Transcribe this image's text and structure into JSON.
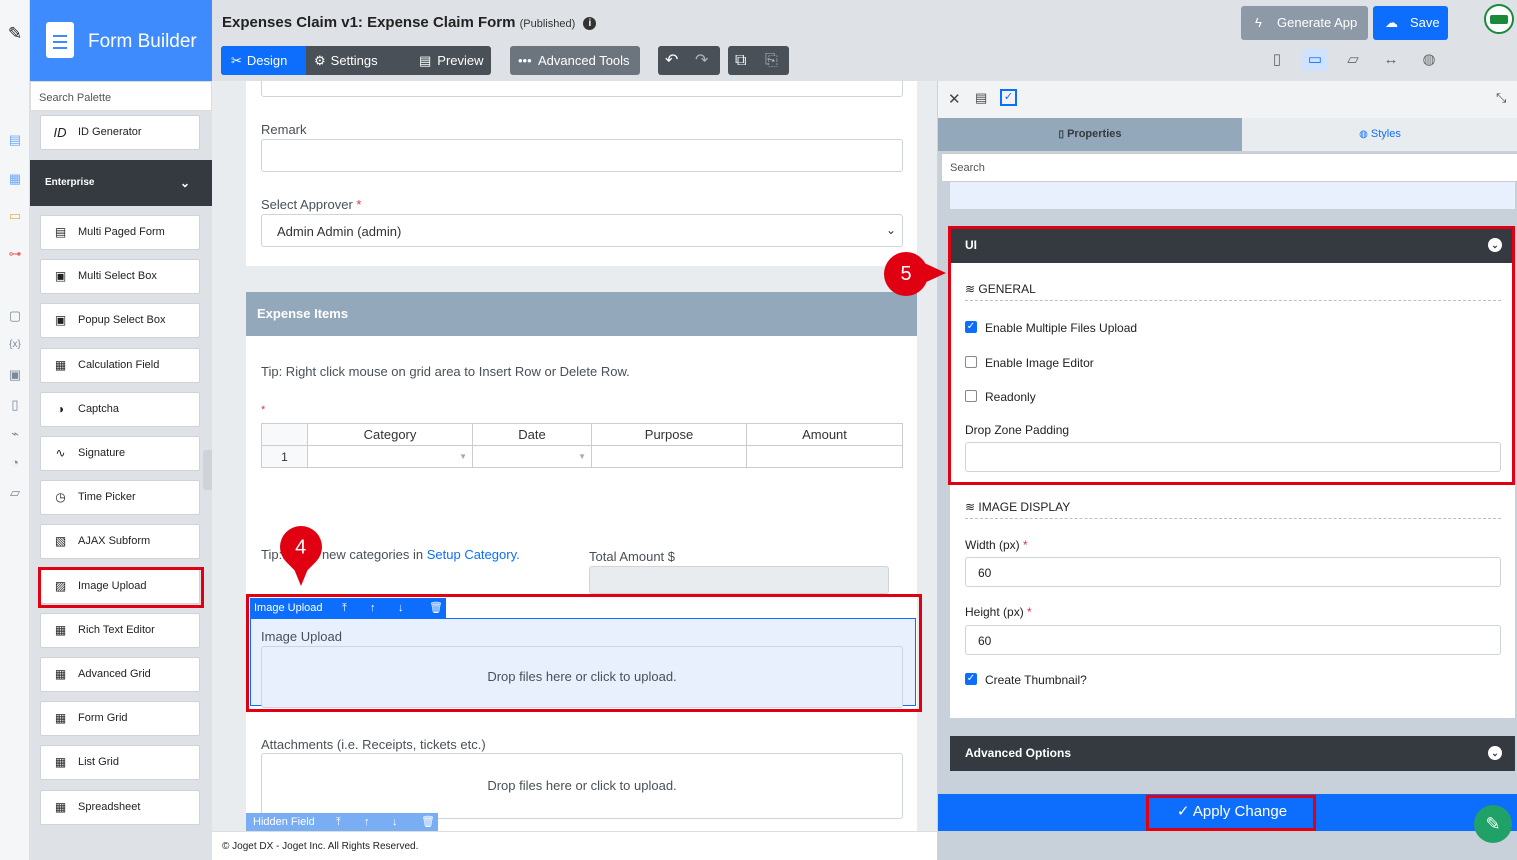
{
  "palette": {
    "title": "Form Builder",
    "search_placeholder": "Search Palette",
    "top_item": "ID Generator",
    "top_item_icon": "ID",
    "category": "Enterprise",
    "items": [
      "Multi Paged Form",
      "Multi Select Box",
      "Popup Select Box",
      "Calculation Field",
      "Captcha",
      "Signature",
      "Time Picker",
      "AJAX Subform",
      "Image Upload",
      "Rich Text Editor",
      "Advanced Grid",
      "Form Grid",
      "List Grid",
      "Spreadsheet"
    ]
  },
  "header": {
    "title": "Expenses Claim v1: Expense Claim Form",
    "status": "(Published)",
    "tabs": [
      "Design",
      "Settings",
      "Preview"
    ],
    "advanced_tools": "Advanced Tools",
    "generate_app": "Generate App",
    "save": "Save"
  },
  "form": {
    "remark_label": "Remark",
    "approver_label": "Select Approver",
    "approver_value": "Admin Admin (admin)",
    "section_title": "Expense Items",
    "tip1": "Tip: Right click mouse on grid area to Insert Row or Delete Row.",
    "grid_headers": [
      "Category",
      "Date",
      "Purpose",
      "Amount"
    ],
    "grid_row_number": "1",
    "tip2_start": "Tip:",
    "tip2_middle": "new categories in",
    "tip2_link": "Setup Category.",
    "total_label": "Total Amount $",
    "selected_element_label": "Image Upload",
    "image_upload_label": "Image Upload",
    "drop_text": "Drop files here or click to upload.",
    "attachments_label": "Attachments (i.e. Receipts, tickets etc.)",
    "attachments_drop_text": "Drop files here or click to upload.",
    "hidden_field_label": "Hidden Field",
    "footer": "© Joget DX - Joget Inc. All Rights Reserved."
  },
  "properties": {
    "tab_properties": "Properties",
    "tab_styles": "Styles",
    "search_placeholder": "Search",
    "ui_section": "UI",
    "general_title": "GENERAL",
    "general_options": [
      {
        "label": "Enable Multiple Files Upload",
        "checked": true
      },
      {
        "label": "Enable Image Editor",
        "checked": false
      },
      {
        "label": "Readonly",
        "checked": false
      }
    ],
    "drop_zone_padding_label": "Drop Zone Padding",
    "image_display_title": "IMAGE DISPLAY",
    "width_label": "Width (px)",
    "width_value": "60",
    "height_label": "Height (px)",
    "height_value": "60",
    "create_thumbnail_label": "Create Thumbnail?",
    "create_thumbnail_checked": true,
    "advanced_options": "Advanced Options",
    "apply_change": "Apply Change"
  },
  "annotations": {
    "marker_4": "4",
    "marker_5": "5"
  },
  "colors": {
    "primary": "#0d6efd",
    "highlight": "#e00012",
    "dark": "#343a40",
    "section": "#93a8bb"
  }
}
